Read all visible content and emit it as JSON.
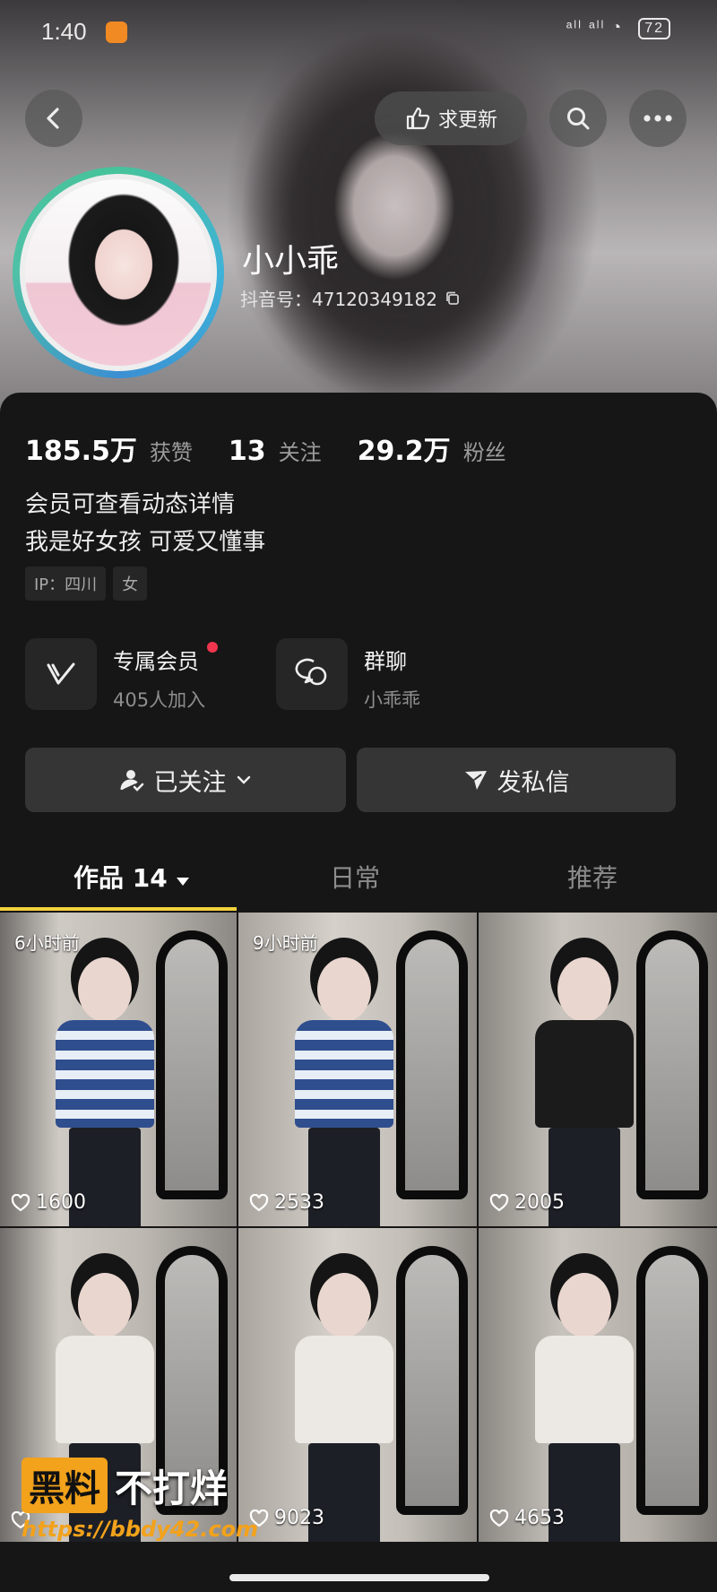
{
  "status_bar": {
    "time": "1:40",
    "signal": "ᵃˡˡ ᵃˡˡ ◔",
    "battery": "72"
  },
  "header": {
    "request_update_label": "求更新",
    "icons": {
      "back": "chevron-left-icon",
      "search": "search-icon",
      "more": "more-icon",
      "thumbs": "thumbs-up-icon"
    }
  },
  "profile": {
    "name": "小小乖",
    "douyin_id": "抖音号：47120349182"
  },
  "stats": [
    {
      "value": "185.5万",
      "label": "获赞"
    },
    {
      "value": "13",
      "label": "关注"
    },
    {
      "value": "29.2万",
      "label": "粉丝"
    }
  ],
  "bio": [
    "会员可查看动态详情",
    "我是好女孩 可爱又懂事"
  ],
  "tags": [
    "IP：四川",
    "女"
  ],
  "features": {
    "member": {
      "title": "专属会员",
      "subtitle": "405人加入"
    },
    "group_chat": {
      "title": "群聊",
      "subtitle": "小乖乖"
    }
  },
  "actions": {
    "follow": "已关注",
    "message": "发私信"
  },
  "tabs": {
    "works": "作品 14",
    "daily": "日常",
    "recommend": "推荐"
  },
  "videos": [
    {
      "time": "6小时前",
      "likes": "1600",
      "outfit": "stripes"
    },
    {
      "time": "9小时前",
      "likes": "2533",
      "outfit": "stripes"
    },
    {
      "time": "",
      "likes": "2005",
      "outfit": "black"
    },
    {
      "time": "",
      "likes": "",
      "outfit": "white"
    },
    {
      "time": "",
      "likes": "9023",
      "outfit": "white"
    },
    {
      "time": "",
      "likes": "4653",
      "outfit": "white"
    }
  ],
  "watermark": {
    "box": "黑料",
    "text": "不打烊",
    "url": "https://bbdy42.com"
  },
  "colors": {
    "accent_underline": "#f2d23d",
    "background": "#161616",
    "watermark": "#f2a21b"
  }
}
